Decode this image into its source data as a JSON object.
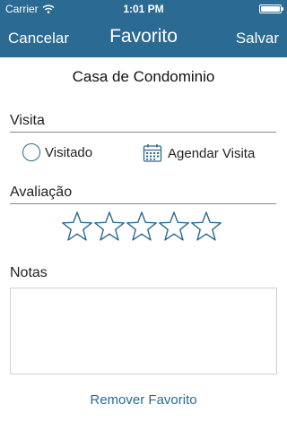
{
  "status_bar": {
    "carrier": "Carrier",
    "time": "1:01 PM"
  },
  "nav": {
    "left_button": "Cancelar",
    "title": "Favorito",
    "right_button": "Salvar"
  },
  "place": {
    "name": "Casa de Condominio"
  },
  "visit": {
    "label": "Visita",
    "visited_option": "Visitado",
    "visited_selected": false,
    "schedule_option": "Agendar Visita"
  },
  "rating": {
    "label": "Avaliação",
    "value": 0,
    "max": 5
  },
  "notes": {
    "label": "Notas",
    "value": ""
  },
  "actions": {
    "remove_favorite": "Remover Favorito"
  },
  "icons": [
    "wifi-icon",
    "battery-icon",
    "radio-icon",
    "calendar-icon",
    "star-icon"
  ],
  "colors": {
    "brand": "#2b6a92",
    "background": "#ffffff",
    "divider": "#8a8a8a",
    "text": "#222222"
  }
}
